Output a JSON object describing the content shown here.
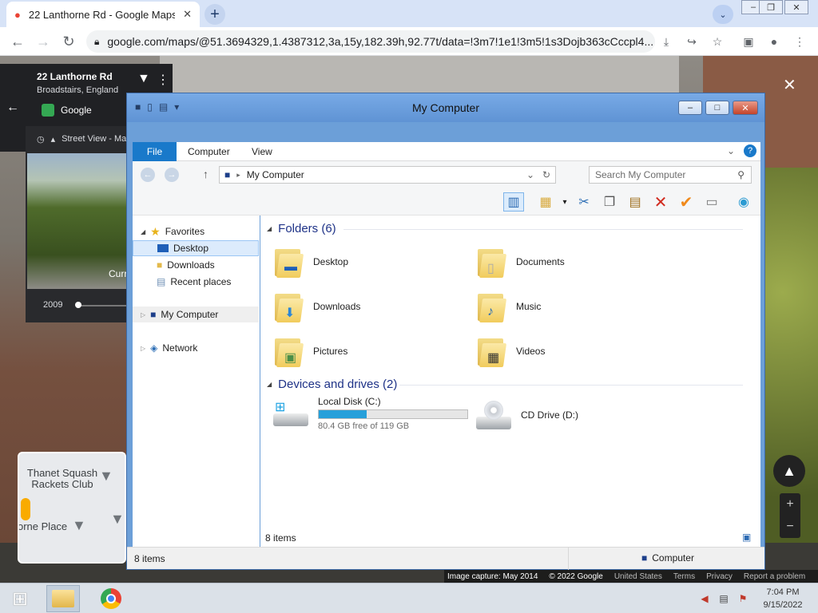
{
  "browser": {
    "tab_title": "22 Lanthorne Rd - Google Maps",
    "new_tab": "+",
    "url": "google.com/maps/@51.3694329,1.4387312,3a,15y,182.39h,92.77t/data=!3m7!1e1!3m5!1s3Dojb363cCccpl4..."
  },
  "maps": {
    "address": "22 Lanthorne Rd",
    "locality": "Broadstairs, England",
    "provider": "Google",
    "street_view_label": "Street View - Ma",
    "street_view_date": "2014",
    "thumb_caption": "Curr",
    "timeline_year": "2009",
    "minimap_label_1": "Thanet Squash Rackets Club",
    "minimap_label_2": "orne Place",
    "attribution": [
      "Image capture: May 2014",
      "© 2022 Google",
      "United States",
      "Terms",
      "Privacy",
      "Report a problem"
    ]
  },
  "explorer": {
    "title": "My Computer",
    "ribbon_tabs": [
      "File",
      "Computer",
      "View"
    ],
    "address_path": "My Computer",
    "search_placeholder": "Search My Computer",
    "nav": {
      "favorites": "Favorites",
      "desktop": "Desktop",
      "downloads": "Downloads",
      "recent": "Recent places",
      "computer": "My Computer",
      "network": "Network"
    },
    "folders_header": "Folders (6)",
    "folders": [
      "Desktop",
      "Documents",
      "Downloads",
      "Music",
      "Pictures",
      "Videos"
    ],
    "drives_header": "Devices and drives (2)",
    "drives": [
      {
        "name": "Local Disk (C:)",
        "free": "80.4 GB free of 119 GB",
        "used_fraction": 0.325
      },
      {
        "name": "CD Drive (D:)"
      }
    ],
    "items_count_inner": "8 items",
    "items_count_status": "8 items",
    "status_location": "Computer"
  },
  "taskbar": {
    "time": "7:04 PM",
    "date": "9/15/2022"
  },
  "colors": {
    "accent": "#1979ca",
    "progress": "#26a0da"
  }
}
